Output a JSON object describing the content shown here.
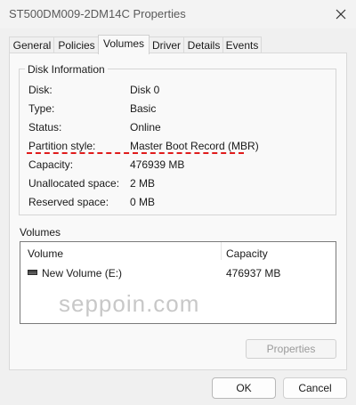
{
  "window": {
    "title": "ST500DM009-2DM14C Properties"
  },
  "tabs": [
    {
      "label": "General"
    },
    {
      "label": "Policies"
    },
    {
      "label": "Volumes"
    },
    {
      "label": "Driver"
    },
    {
      "label": "Details"
    },
    {
      "label": "Events"
    }
  ],
  "active_tab": "Volumes",
  "disk_info": {
    "legend": "Disk Information",
    "rows": [
      {
        "label": "Disk:",
        "value": "Disk 0"
      },
      {
        "label": "Type:",
        "value": "Basic"
      },
      {
        "label": "Status:",
        "value": "Online"
      },
      {
        "label": "Partition style:",
        "value": "Master Boot Record (MBR)"
      },
      {
        "label": "Capacity:",
        "value": "476939 MB"
      },
      {
        "label": "Unallocated space:",
        "value": "2 MB"
      },
      {
        "label": "Reserved space:",
        "value": "0 MB"
      }
    ]
  },
  "volumes": {
    "title": "Volumes",
    "columns": [
      "Volume",
      "Capacity"
    ],
    "rows": [
      {
        "volume": "New Volume (E:)",
        "capacity": "476937 MB"
      }
    ]
  },
  "watermark": "seppoin.com",
  "buttons": {
    "properties": "Properties",
    "ok": "OK",
    "cancel": "Cancel"
  },
  "colors": {
    "highlight_underline": "#e01b1b"
  }
}
